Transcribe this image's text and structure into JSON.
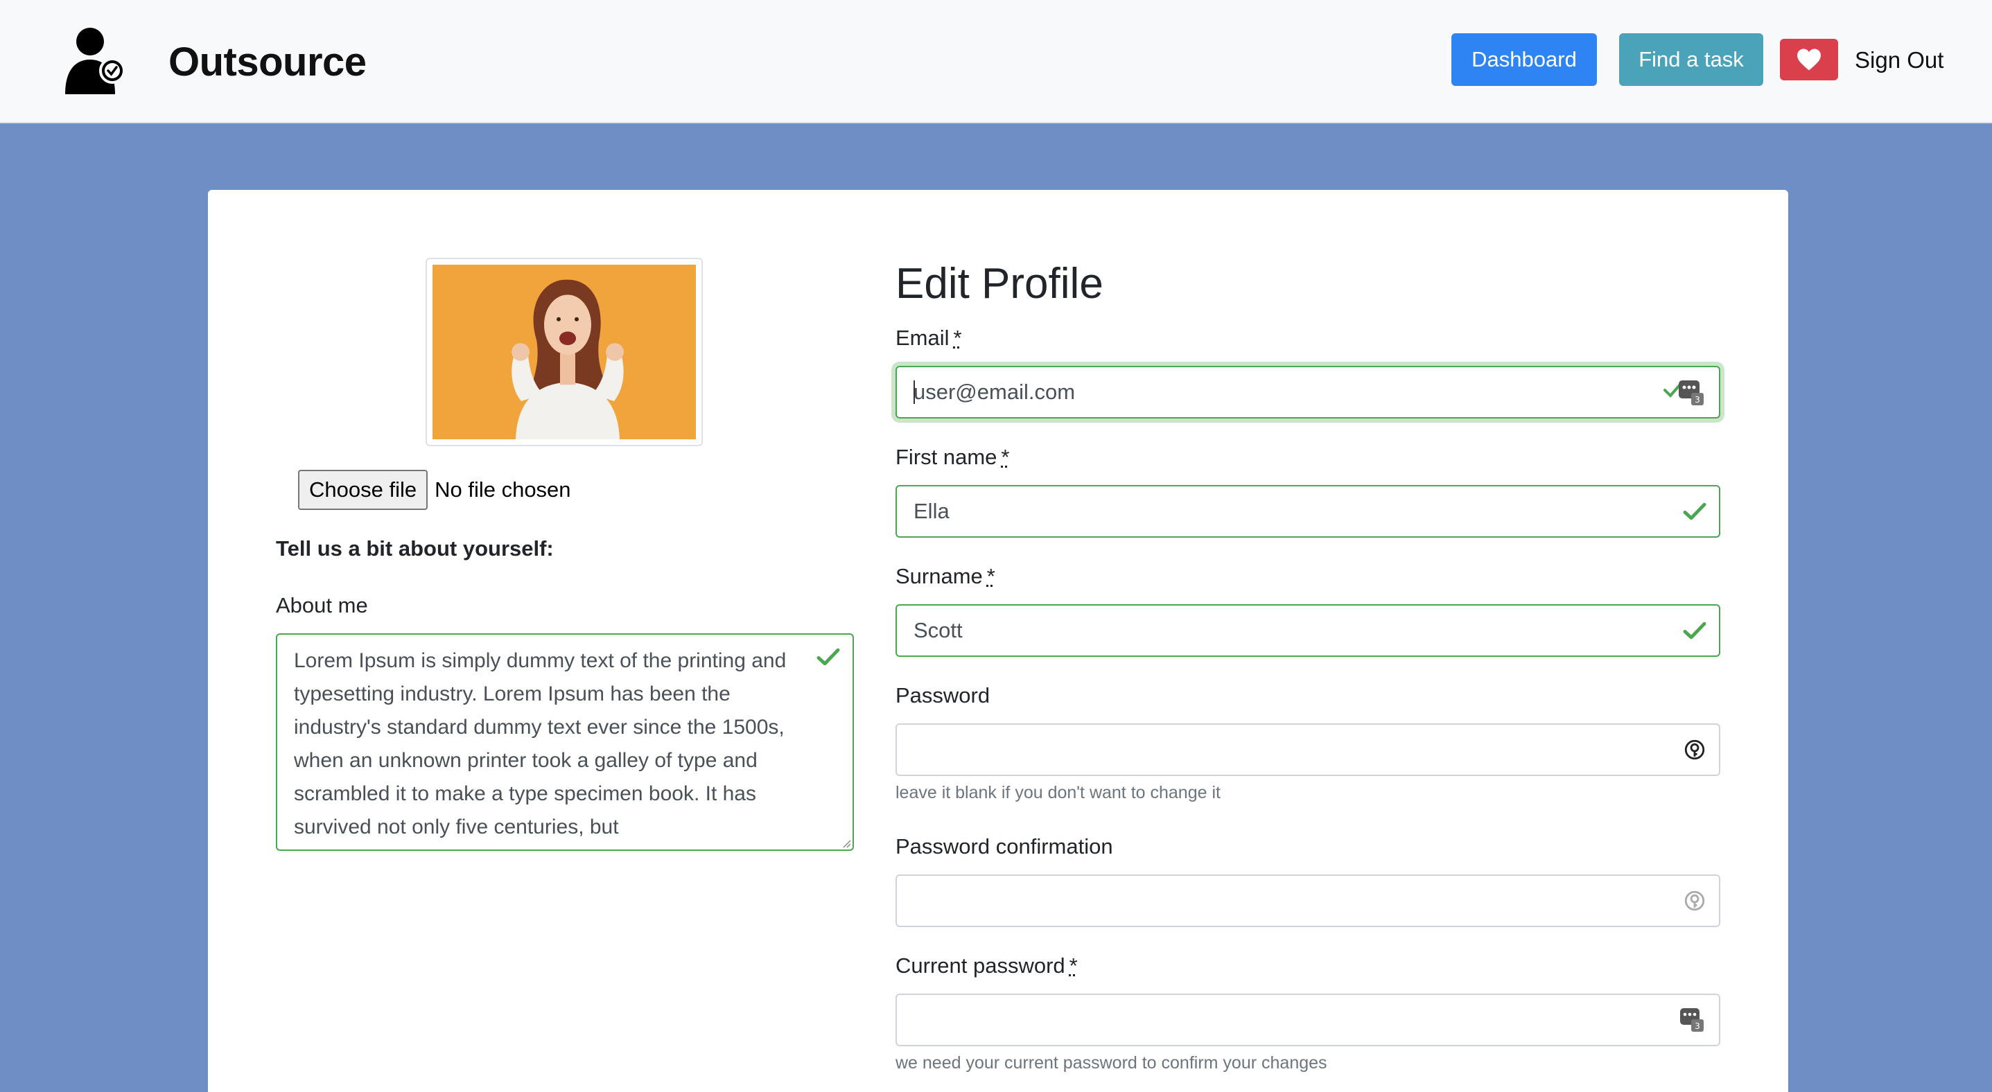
{
  "navbar": {
    "brand": "Outsource",
    "dashboard_label": "Dashboard",
    "find_task_label": "Find a task",
    "favorites_icon": "heart-icon",
    "sign_out_label": "Sign Out"
  },
  "sidebar": {
    "file_button_label": "Choose file",
    "file_status": "No file chosen",
    "tell_us_heading": "Tell us a bit about yourself:",
    "about_label": "About me",
    "about_text": "Lorem Ipsum is simply dummy text of the printing and typesetting industry. Lorem Ipsum has been the industry's standard dummy text ever since the 1500s, when an unknown printer took a galley of type and scrambled it to make a type specimen book. It has survived not only five centuries, but"
  },
  "form": {
    "title": "Edit Profile",
    "required_marker": "*",
    "email_label": "Email",
    "email_value": "user@email.com",
    "first_name_label": "First name",
    "first_name_value": "Ella",
    "surname_label": "Surname",
    "surname_value": "Scott",
    "password_label": "Password",
    "password_help": "leave it blank if you don't want to change it",
    "password_confirmation_label": "Password confirmation",
    "current_password_label": "Current password",
    "current_password_help": "we need your current password to confirm your changes"
  },
  "colors": {
    "page_background": "#6e8ec5",
    "primary": "#2f84f3",
    "info": "#4aa3b8",
    "danger": "#d9404c",
    "valid": "#4aa64f"
  }
}
